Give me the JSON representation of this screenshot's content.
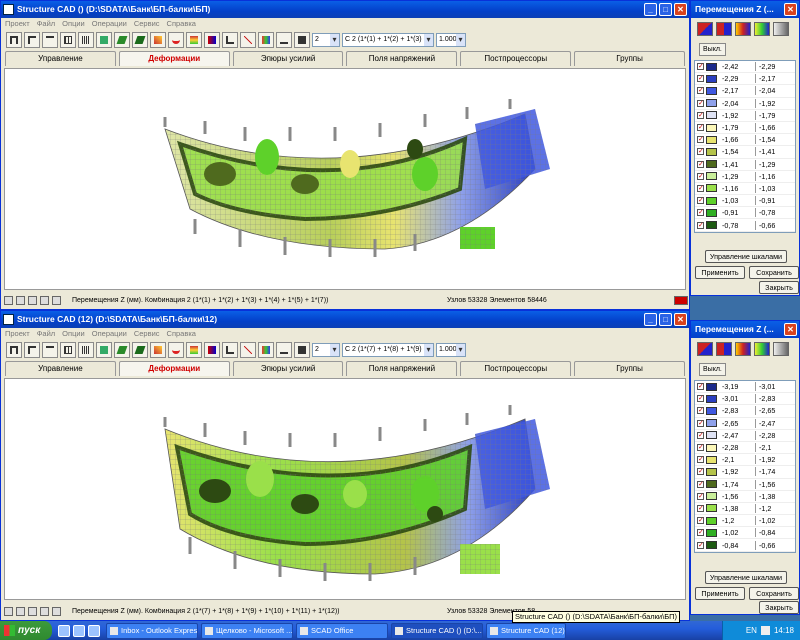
{
  "window1": {
    "title": "Structure CAD () (D:\\SDATA\\Банк\\БП-балки\\БП)",
    "menu": [
      "Проект",
      "Файл",
      "Опции",
      "Операции",
      "Сервис",
      "Справка"
    ],
    "combo_num": "2",
    "combo_comb": "C 2 (1*(1) + 1*(2) + 1*(3) + 1*",
    "combo_scale": "1.000",
    "tabs": [
      "Управление",
      "Деформации",
      "Эпюры усилий",
      "Поля напряжений",
      "Постпроцессоры",
      "Группы"
    ],
    "status_text": "Перемещения Z (мм). Комбинация 2 (1*(1) + 1*(2) + 1*(3) + 1*(4) + 1*(5) + 1*(7))",
    "status_nodes": "Узлов 53328 Элементов 58446"
  },
  "window2": {
    "title": "Structure CAD (12) (D:\\SDATA\\Банк\\БП-балки\\12)",
    "menu": [
      "Проект",
      "Файл",
      "Опции",
      "Операции",
      "Сервис",
      "Справка"
    ],
    "combo_num": "2",
    "combo_comb": "C 2 (1*(7) + 1*(8) + 1*(9) + 1*",
    "combo_scale": "1.000",
    "tabs": [
      "Управление",
      "Деформации",
      "Эпюры усилий",
      "Поля напряжений",
      "Постпроцессоры",
      "Группы"
    ],
    "status_text": "Перемещения Z (мм). Комбинация 2 (1*(7) + 1*(8) + 1*(9) + 1*(10) + 1*(11) + 1*(12))",
    "status_nodes": "Узлов 53328 Элементов 58"
  },
  "panel1": {
    "title": "Перемещения Z (...",
    "off_label": "Выкл.",
    "legend": [
      {
        "color": "#1a2a8c",
        "from": "-2,42",
        "to": "-2,29"
      },
      {
        "color": "#2a3ec0",
        "from": "-2,29",
        "to": "-2,17"
      },
      {
        "color": "#3f58e0",
        "from": "-2,17",
        "to": "-2,04"
      },
      {
        "color": "#8ea0ea",
        "from": "-2,04",
        "to": "-1,92"
      },
      {
        "color": "#dfe3f5",
        "from": "-1,92",
        "to": "-1,79"
      },
      {
        "color": "#fbf7b8",
        "from": "-1,79",
        "to": "-1,66"
      },
      {
        "color": "#e8e470",
        "from": "-1,66",
        "to": "-1,54"
      },
      {
        "color": "#b4c34a",
        "from": "-1,54",
        "to": "-1,41"
      },
      {
        "color": "#4f6a1e",
        "from": "-1,41",
        "to": "-1,29"
      },
      {
        "color": "#c9ef9a",
        "from": "-1,29",
        "to": "-1,16"
      },
      {
        "color": "#9ae04a",
        "from": "-1,16",
        "to": "-1,03"
      },
      {
        "color": "#5ed12a",
        "from": "-1,03",
        "to": "-0,91"
      },
      {
        "color": "#2fae22",
        "from": "-0,91",
        "to": "-0,78"
      },
      {
        "color": "#1d5a12",
        "from": "-0,78",
        "to": "-0,66"
      }
    ],
    "btn_scales": "Управление шкалами",
    "btn_apply": "Применить",
    "btn_save": "Сохранить",
    "btn_close": "Закрыть"
  },
  "panel2": {
    "title": "Перемещения Z (...",
    "off_label": "Выкл.",
    "legend": [
      {
        "color": "#1a2a8c",
        "from": "-3,19",
        "to": "-3,01"
      },
      {
        "color": "#2a3ec0",
        "from": "-3,01",
        "to": "-2,83"
      },
      {
        "color": "#3f58e0",
        "from": "-2,83",
        "to": "-2,65"
      },
      {
        "color": "#8ea0ea",
        "from": "-2,65",
        "to": "-2,47"
      },
      {
        "color": "#dfe3f5",
        "from": "-2,47",
        "to": "-2,28"
      },
      {
        "color": "#fbf7b8",
        "from": "-2,28",
        "to": "-2,1"
      },
      {
        "color": "#e8e470",
        "from": "-2,1",
        "to": "-1,92"
      },
      {
        "color": "#b4c34a",
        "from": "-1,92",
        "to": "-1,74"
      },
      {
        "color": "#4f6a1e",
        "from": "-1,74",
        "to": "-1,56"
      },
      {
        "color": "#c9ef9a",
        "from": "-1,56",
        "to": "-1,38"
      },
      {
        "color": "#9ae04a",
        "from": "-1,38",
        "to": "-1,2"
      },
      {
        "color": "#5ed12a",
        "from": "-1,2",
        "to": "-1,02"
      },
      {
        "color": "#2fae22",
        "from": "-1,02",
        "to": "-0,84"
      },
      {
        "color": "#1d5a12",
        "from": "-0,84",
        "to": "-0,66"
      }
    ],
    "btn_scales": "Управление шкалами",
    "btn_apply": "Применить",
    "btn_save": "Сохранить",
    "btn_close": "Закрыть"
  },
  "taskbar": {
    "start": "пуск",
    "tasks": [
      "Inbox - Outlook Express",
      "Щелково - Microsoft ...",
      "SCAD Office",
      "Structure CAD () (D:\\...",
      "Structure CAD (12) (D:..."
    ],
    "lang": "EN",
    "clock": "14:18",
    "tooltip": "Structure CAD () (D:\\SDATA\\Банк\\БП-балки\\БП)"
  }
}
